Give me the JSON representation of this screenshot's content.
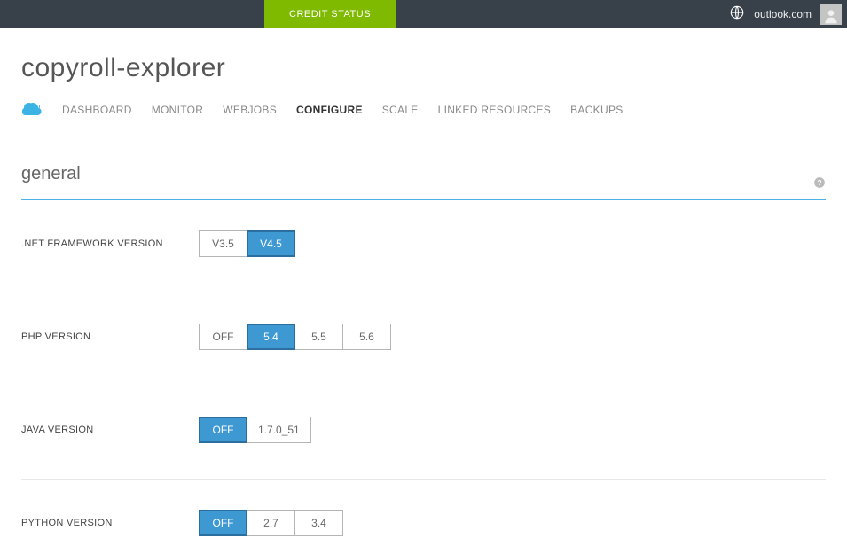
{
  "topbar": {
    "credit_status": "CREDIT STATUS",
    "account": "outlook.com"
  },
  "page": {
    "title": "copyroll-explorer"
  },
  "tabs": [
    {
      "label": "DASHBOARD",
      "active": false
    },
    {
      "label": "MONITOR",
      "active": false
    },
    {
      "label": "WEBJOBS",
      "active": false
    },
    {
      "label": "CONFIGURE",
      "active": true
    },
    {
      "label": "SCALE",
      "active": false
    },
    {
      "label": "LINKED RESOURCES",
      "active": false
    },
    {
      "label": "BACKUPS",
      "active": false
    }
  ],
  "section": {
    "title": "general"
  },
  "settings": {
    "net_framework": {
      "label": ".NET FRAMEWORK VERSION",
      "options": [
        "V3.5",
        "V4.5"
      ],
      "selected": "V4.5"
    },
    "php_version": {
      "label": "PHP VERSION",
      "options": [
        "OFF",
        "5.4",
        "5.5",
        "5.6"
      ],
      "selected": "5.4"
    },
    "java_version": {
      "label": "JAVA VERSION",
      "options": [
        "OFF",
        "1.7.0_51"
      ],
      "selected": "OFF"
    },
    "python_version": {
      "label": "PYTHON VERSION",
      "options": [
        "OFF",
        "2.7",
        "3.4"
      ],
      "selected": "OFF"
    }
  }
}
